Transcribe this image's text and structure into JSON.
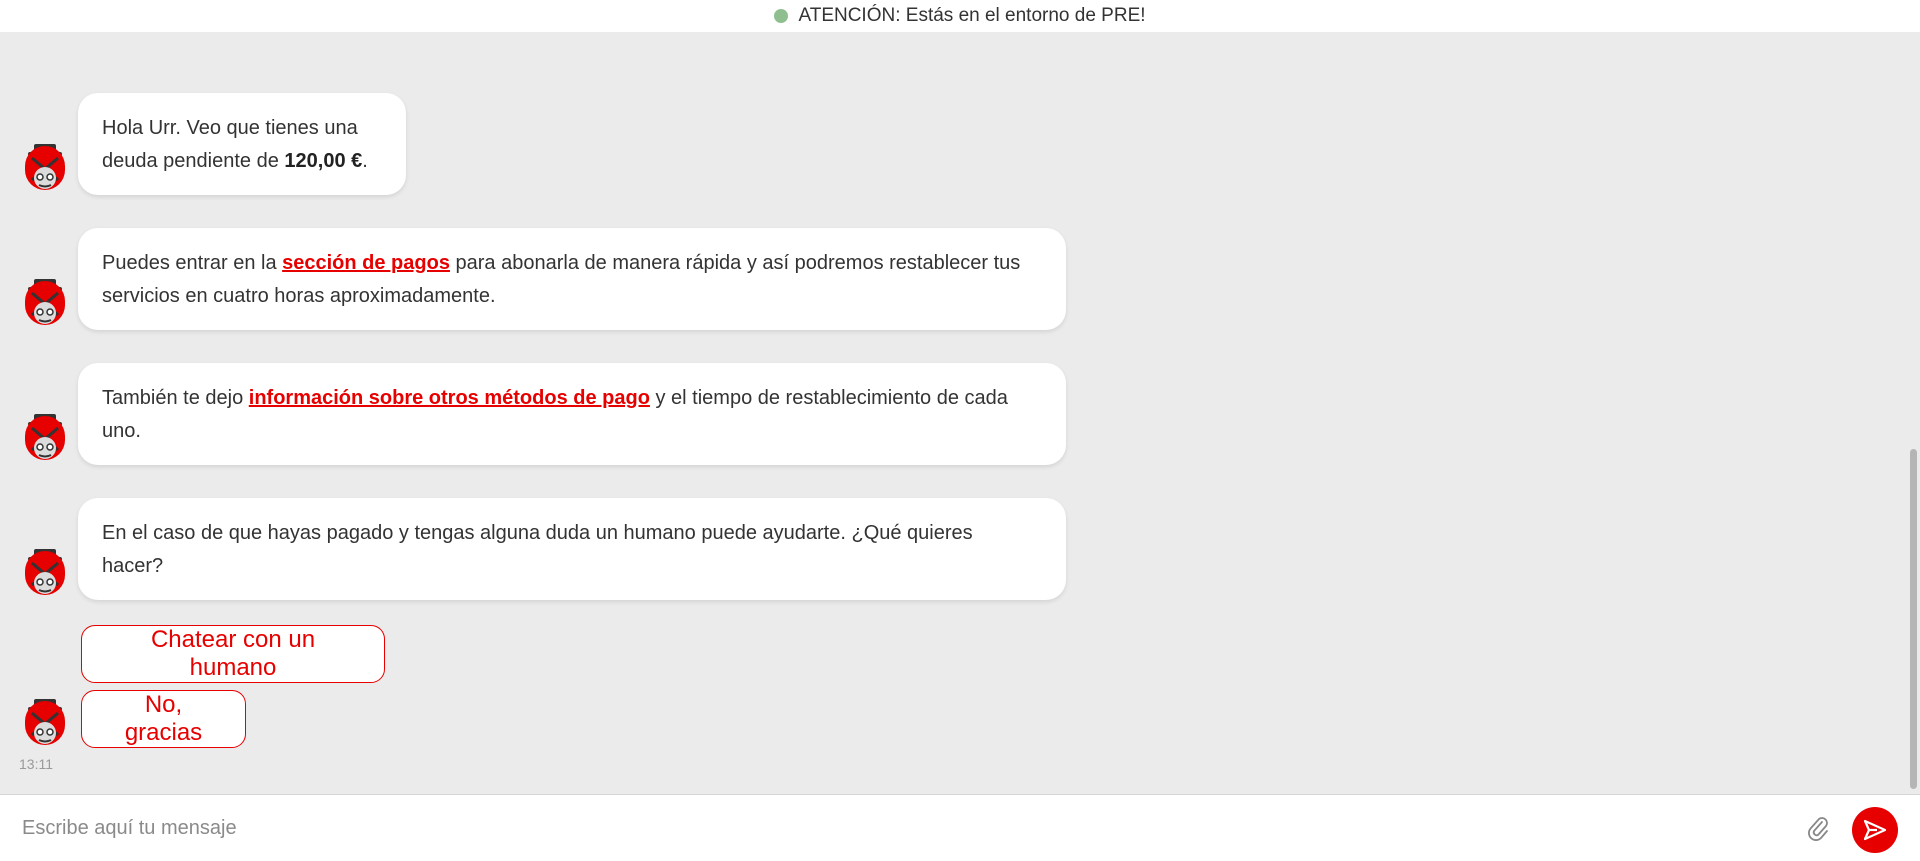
{
  "banner": {
    "status_color": "#8fbf8f",
    "text": "ATENCIÓN: Estás en el entorno de PRE!"
  },
  "messages": [
    {
      "parts": [
        "Hola Urr. Veo que tienes una",
        "deuda pendiente de ",
        "120,00 €",
        "."
      ]
    },
    {
      "pre": "Puedes entrar en la ",
      "link": "sección de pagos",
      "post1": " para abonarla de manera rápida y así podremos restablecer tus",
      "post2": "servicios en cuatro horas aproximadamente."
    },
    {
      "pre": "También te dejo ",
      "link": "información sobre otros métodos de pago",
      "post1": " y el tiempo de restablecimiento de cada",
      "post2": "uno."
    },
    {
      "line1": "En el caso de que hayas pagado y tengas alguna duda un humano puede ayudarte. ¿Qué quieres",
      "line2": "hacer?"
    }
  ],
  "quick_replies": [
    "Chatear con un humano",
    "No, gracias"
  ],
  "timestamp": "13:11",
  "composer": {
    "placeholder": "Escribe aquí tu mensaje",
    "attach_icon": "paperclip-icon",
    "send_icon": "send-icon"
  },
  "colors": {
    "accent": "#e60000",
    "background": "#ebebeb",
    "bubble": "#ffffff"
  }
}
